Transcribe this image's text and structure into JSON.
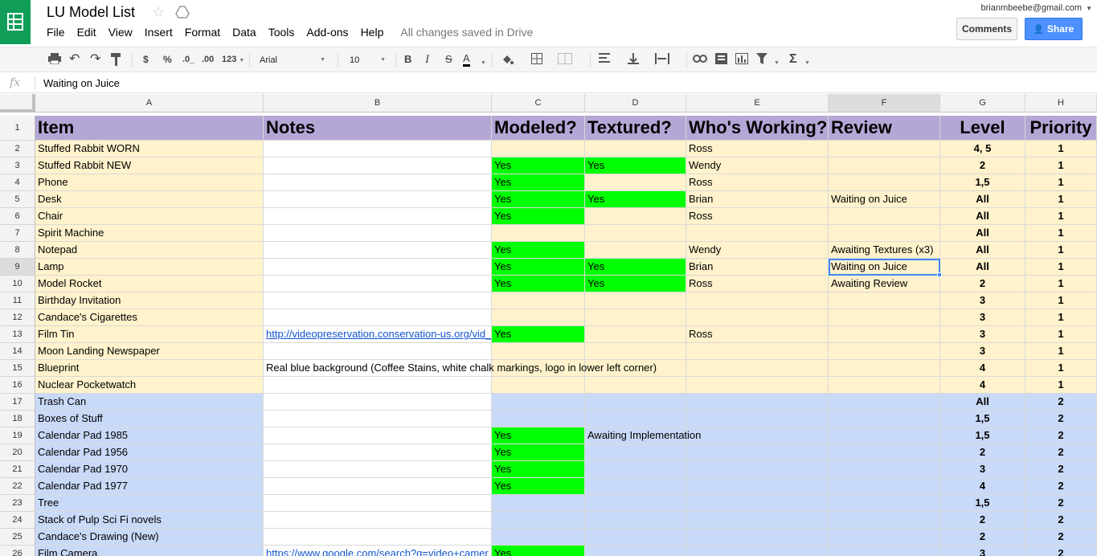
{
  "app": {
    "title": "LU Model List",
    "account": "brianmbeebe@gmail.com",
    "comments_label": "Comments",
    "share_label": "Share",
    "saved_status": "All changes saved in Drive"
  },
  "menu": [
    "File",
    "Edit",
    "View",
    "Insert",
    "Format",
    "Data",
    "Tools",
    "Add-ons",
    "Help"
  ],
  "toolbar": {
    "currency": "$",
    "percent": "%",
    "dec_decrease": ".0_",
    "dec_increase": ".00",
    "more_formats": "123",
    "font": "Arial",
    "font_size": "10",
    "bold": "B",
    "italic": "I",
    "strike": "S",
    "text_color": "A",
    "sigma": "Σ"
  },
  "formula_bar": {
    "fx": "fx",
    "content": "Waiting on Juice"
  },
  "colors": {
    "header_purple": "#b4a7d6",
    "light_yellow": "#fff2cc",
    "light_blue": "#c9daf8",
    "green": "#00ff00",
    "share_blue": "#4d90fe",
    "sheets_green": "#0f9d58"
  },
  "columns": [
    "A",
    "B",
    "C",
    "D",
    "E",
    "F",
    "G",
    "H"
  ],
  "selected": {
    "row": 9,
    "col": "F"
  },
  "rows": [
    {
      "n": "1",
      "fill": "hdr",
      "cells": [
        "Item",
        "Notes",
        "Modeled?",
        "Textured?",
        "Who's Working?",
        "Review",
        "Level",
        "Priority"
      ]
    },
    {
      "n": "2",
      "fill": "yellow",
      "cells": [
        "Stuffed Rabbit WORN",
        "",
        "",
        "",
        "Ross",
        "",
        "4, 5",
        "1"
      ]
    },
    {
      "n": "3",
      "fill": "yellow",
      "cells": [
        "Stuffed Rabbit NEW",
        "",
        "Yes",
        "Yes",
        "Wendy",
        "",
        "2",
        "1"
      ]
    },
    {
      "n": "4",
      "fill": "yellow",
      "cells": [
        "Phone",
        "",
        "Yes",
        "",
        "Ross",
        "",
        "1,5",
        "1"
      ]
    },
    {
      "n": "5",
      "fill": "yellow",
      "cells": [
        "Desk",
        "",
        "Yes",
        "Yes",
        "Brian",
        "Waiting on Juice",
        "All",
        "1"
      ]
    },
    {
      "n": "6",
      "fill": "yellow",
      "cells": [
        "Chair",
        "",
        "Yes",
        "",
        "Ross",
        "",
        "All",
        "1"
      ]
    },
    {
      "n": "7",
      "fill": "yellow",
      "cells": [
        "Spirit Machine",
        "",
        "",
        "",
        "",
        "",
        "All",
        "1"
      ]
    },
    {
      "n": "8",
      "fill": "yellow",
      "cells": [
        "Notepad",
        "",
        "Yes",
        "",
        "Wendy",
        "Awaiting Textures (x3)",
        "All",
        "1"
      ]
    },
    {
      "n": "9",
      "fill": "yellow",
      "cells": [
        "Lamp",
        "",
        "Yes",
        "Yes",
        "Brian",
        "Waiting on Juice",
        "All",
        "1"
      ]
    },
    {
      "n": "10",
      "fill": "yellow",
      "cells": [
        "Model Rocket",
        "",
        "Yes",
        "Yes",
        "Ross",
        "Awaiting Review",
        "2",
        "1"
      ]
    },
    {
      "n": "11",
      "fill": "yellow",
      "cells": [
        "Birthday Invitation",
        "",
        "",
        "",
        "",
        "",
        "3",
        "1"
      ]
    },
    {
      "n": "12",
      "fill": "yellow",
      "cells": [
        "Candace's Cigarettes",
        "",
        "",
        "",
        "",
        "",
        "3",
        "1"
      ]
    },
    {
      "n": "13",
      "fill": "yellow",
      "cells": [
        "Film Tin",
        "http://videopreservation.conservation-us.org/vid_",
        "Yes",
        "",
        "Ross",
        "",
        "3",
        "1"
      ]
    },
    {
      "n": "14",
      "fill": "yellow",
      "cells": [
        "Moon Landing Newspaper",
        "",
        "",
        "",
        "",
        "",
        "3",
        "1"
      ]
    },
    {
      "n": "15",
      "fill": "yellow",
      "cells": [
        "Blueprint",
        "Real blue background (Coffee Stains, white chalk markings, logo in lower left corner)",
        "",
        "",
        "",
        "",
        "4",
        "1"
      ]
    },
    {
      "n": "16",
      "fill": "yellow",
      "cells": [
        "Nuclear Pocketwatch",
        "",
        "",
        "",
        "",
        "",
        "4",
        "1"
      ]
    },
    {
      "n": "17",
      "fill": "blue",
      "cells": [
        "Trash Can",
        "",
        "",
        "",
        "",
        "",
        "All",
        "2"
      ]
    },
    {
      "n": "18",
      "fill": "blue",
      "cells": [
        "Boxes of Stuff",
        "",
        "",
        "",
        "",
        "",
        "1,5",
        "2"
      ]
    },
    {
      "n": "19",
      "fill": "blue",
      "cells": [
        "Calendar Pad 1985",
        "",
        "Yes",
        "Awaiting Implementation",
        "",
        "",
        "1,5",
        "2"
      ]
    },
    {
      "n": "20",
      "fill": "blue",
      "cells": [
        "Calendar Pad 1956",
        "",
        "Yes",
        "",
        "",
        "",
        "2",
        "2"
      ]
    },
    {
      "n": "21",
      "fill": "blue",
      "cells": [
        "Calendar Pad 1970",
        "",
        "Yes",
        "",
        "",
        "",
        "3",
        "2"
      ]
    },
    {
      "n": "22",
      "fill": "blue",
      "cells": [
        "Calendar Pad 1977",
        "",
        "Yes",
        "",
        "",
        "",
        "4",
        "2"
      ]
    },
    {
      "n": "23",
      "fill": "blue",
      "cells": [
        "Tree",
        "",
        "",
        "",
        "",
        "",
        "1,5",
        "2"
      ]
    },
    {
      "n": "24",
      "fill": "blue",
      "cells": [
        "Stack of Pulp Sci Fi novels",
        "",
        "",
        "",
        "",
        "",
        "2",
        "2"
      ]
    },
    {
      "n": "25",
      "fill": "blue",
      "cells": [
        "Candace's Drawing (New)",
        "",
        "",
        "",
        "",
        "",
        "2",
        "2"
      ]
    },
    {
      "n": "26",
      "fill": "blue",
      "cells": [
        "Film Camera",
        "https://www.google.com/search?q=video+camer",
        "Yes",
        "",
        "",
        "",
        "3",
        "2"
      ]
    }
  ]
}
